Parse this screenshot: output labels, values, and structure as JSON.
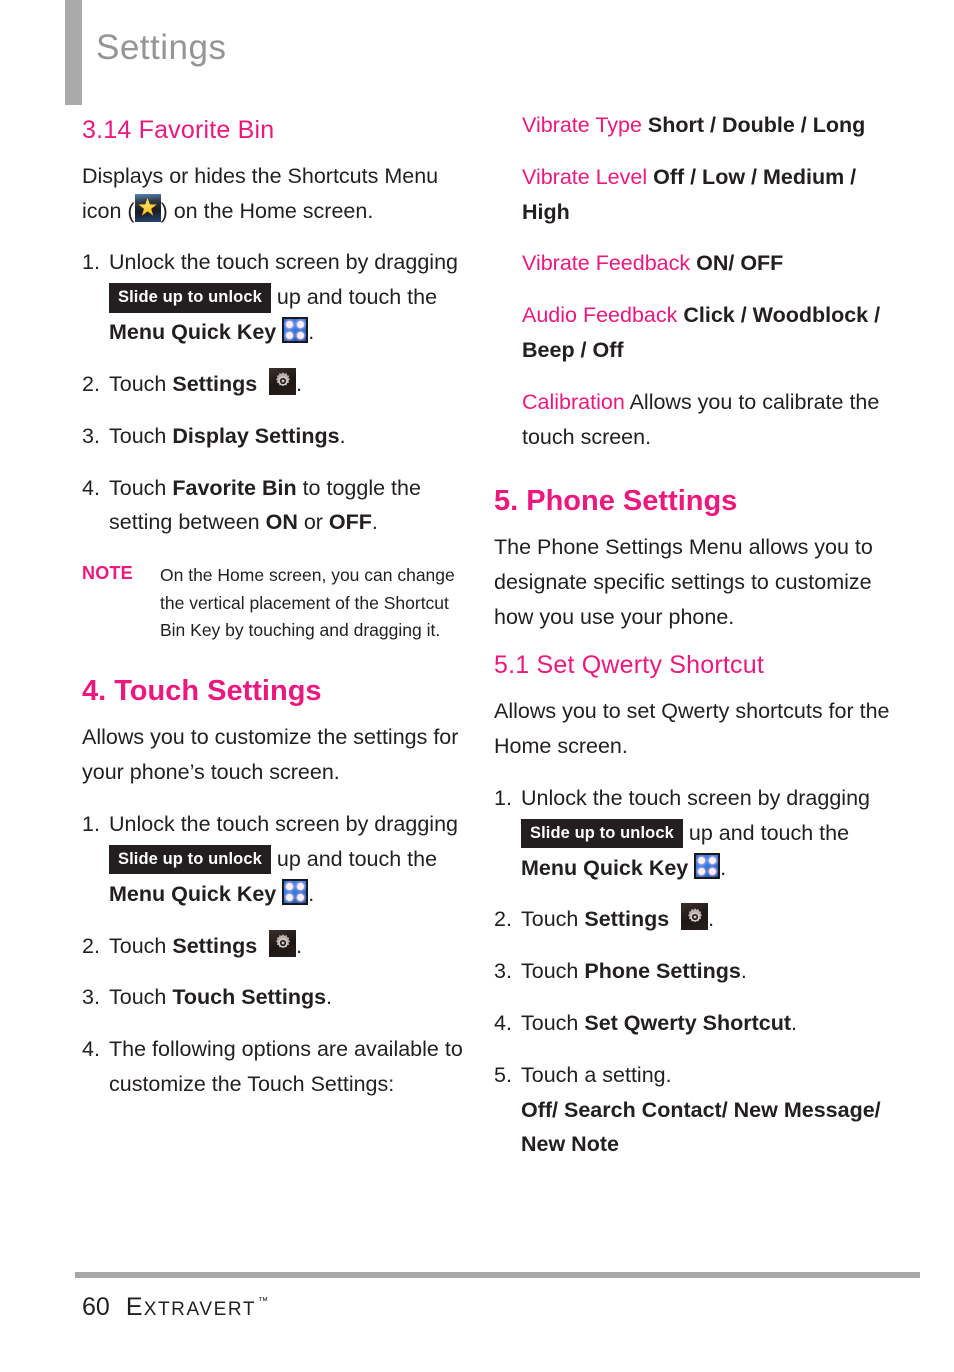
{
  "header": {
    "title": "Settings"
  },
  "left_column": {
    "section_3_14": {
      "heading": "3.14 Favorite Bin",
      "intro_a": "Displays or hides the Shortcuts Menu icon (",
      "intro_b": ") on the Home screen.",
      "steps": [
        {
          "num": "1.",
          "a": "Unlock the touch screen by dragging ",
          "badge": "Slide up to unlock",
          "b": " up and touch the ",
          "bold": "Menu Quick Key",
          "c": "."
        },
        {
          "num": "2.",
          "a": "Touch ",
          "bold": "Settings",
          "c": "."
        },
        {
          "num": "3.",
          "a": "Touch ",
          "bold": "Display Settings",
          "c": "."
        },
        {
          "num": "4.",
          "a": "Touch ",
          "bold": "Favorite Bin",
          "b": " to toggle the setting between ",
          "bold2": "ON",
          "c": " or ",
          "bold3": "OFF",
          "d": "."
        }
      ],
      "note": {
        "label": "NOTE",
        "text": "On the Home screen, you can change the vertical placement of the Shortcut Bin Key by touching and dragging it."
      }
    },
    "section_4": {
      "heading": "4. Touch Settings",
      "intro": "Allows you to customize the settings for your phone’s touch screen.",
      "steps": [
        {
          "num": "1.",
          "a": "Unlock the touch screen by dragging ",
          "badge": "Slide up to unlock",
          "b": " up and touch the ",
          "bold": "Menu Quick Key",
          "c": "."
        },
        {
          "num": "2.",
          "a": "Touch ",
          "bold": "Settings",
          "c": "."
        },
        {
          "num": "3.",
          "a": "Touch ",
          "bold": "Touch Settings",
          "c": "."
        },
        {
          "num": "4.",
          "a": "The following options are available to customize the Touch Settings:"
        }
      ]
    }
  },
  "right_column": {
    "touch_options": [
      {
        "name": "Vibrate Type",
        "values": "Short / Double / Long"
      },
      {
        "name": "Vibrate Level",
        "values": "Off / Low / Medium / High"
      },
      {
        "name": "Vibrate Feedback",
        "values": "ON/ OFF"
      },
      {
        "name": "Audio Feedback",
        "values": "Click / Woodblock / Beep / Off"
      },
      {
        "name": "Calibration",
        "values": "",
        "description": "Allows you to calibrate the touch screen."
      }
    ],
    "section_5": {
      "heading": "5. Phone Settings",
      "intro": "The Phone Settings Menu allows you to designate specific settings to customize how you use your phone."
    },
    "section_5_1": {
      "heading": "5.1 Set Qwerty Shortcut",
      "intro": "Allows you to set Qwerty shortcuts for the Home screen.",
      "steps": [
        {
          "num": "1.",
          "a": "Unlock the touch screen by dragging ",
          "badge": "Slide up to unlock",
          "b": " up and touch the ",
          "bold": "Menu Quick Key",
          "c": "."
        },
        {
          "num": "2.",
          "a": "Touch ",
          "bold": "Settings",
          "c": "."
        },
        {
          "num": "3.",
          "a": "Touch ",
          "bold": "Phone Settings",
          "c": "."
        },
        {
          "num": "4.",
          "a": "Touch ",
          "bold": "Set Qwerty Shortcut",
          "c": "."
        },
        {
          "num": "5.",
          "a": "Touch a setting.",
          "bold": "Off/ Search Contact/ New Message/ New Note"
        }
      ]
    }
  },
  "footer": {
    "page_number": "60",
    "brand_first_letter": "E",
    "brand_rest": "XTRAVERT",
    "trademark": "™"
  },
  "colors": {
    "accent_pink": "#ec187e",
    "header_gray": "#959595",
    "bar_gray": "#aaaaaa",
    "body_black": "#231f20"
  },
  "icons": {
    "star": "favorite-bin-star-icon",
    "quick_key": "menu-quick-key-icon",
    "gear": "settings-gear-icon"
  }
}
